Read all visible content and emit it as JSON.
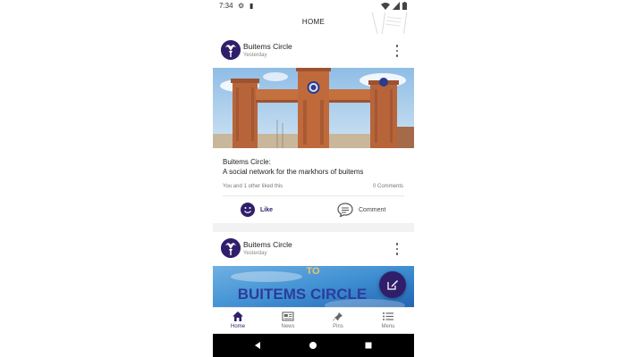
{
  "status_bar": {
    "time": "7:34",
    "left_icons": [
      "gear-icon",
      "sd-card-icon"
    ],
    "right_icons": [
      "wifi-icon",
      "signal-icon",
      "battery-icon"
    ]
  },
  "app_bar": {
    "title": "HOME"
  },
  "posts": [
    {
      "author": "Buitems Circle",
      "time": "Yesterday",
      "caption_line1": "Buitems Circle:",
      "caption_line2": "A social network for the markhors of buitems",
      "likes_text": "You and 1 other liked this",
      "comments_text": "0 Comments"
    },
    {
      "author": "Buitems Circle",
      "time": "Yesterday",
      "banner_small": "TO",
      "banner_big": "BUITEMS CIRCLE"
    }
  ],
  "actions": {
    "like": "Like",
    "comment": "Comment"
  },
  "bottom_nav": [
    {
      "label": "Home",
      "icon": "home-icon",
      "active": true
    },
    {
      "label": "News",
      "icon": "newspaper-icon",
      "active": false
    },
    {
      "label": "Pins",
      "icon": "pin-icon",
      "active": false
    },
    {
      "label": "Menu",
      "icon": "menu-icon",
      "active": false
    }
  ],
  "colors": {
    "primary": "#2f1f6b",
    "background": "#f2f2f2",
    "sky": "#a9cdeb",
    "brick": "#b8643a"
  }
}
